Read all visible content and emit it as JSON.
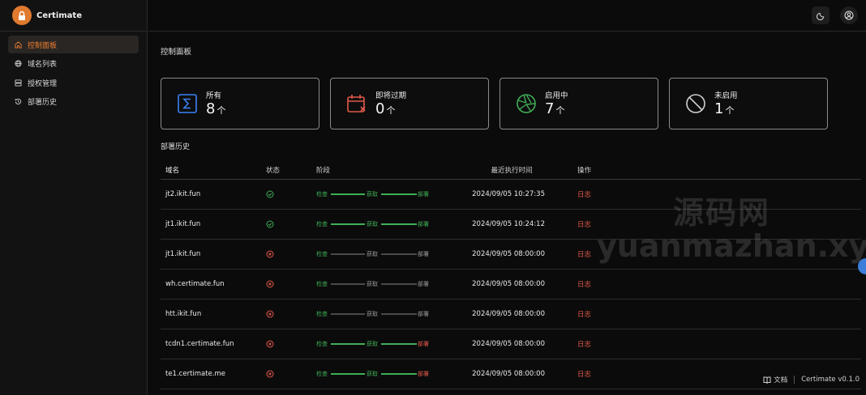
{
  "brand": {
    "name": "Certimate"
  },
  "sidebar": {
    "items": [
      {
        "label": "控制面板",
        "icon": "home-icon",
        "active": true
      },
      {
        "label": "域名列表",
        "icon": "globe-icon",
        "active": false
      },
      {
        "label": "授权管理",
        "icon": "server-icon",
        "active": false
      },
      {
        "label": "部署历史",
        "icon": "history-icon",
        "active": false
      }
    ]
  },
  "header": {
    "theme_icon": "moon-icon",
    "user_icon": "user-circle-icon"
  },
  "main": {
    "title": "控制面板",
    "cards": [
      {
        "label": "所有",
        "value": "8",
        "unit": "个",
        "icon": "sigma-icon",
        "color": "#3b82f6"
      },
      {
        "label": "即将过期",
        "value": "0",
        "unit": "个",
        "icon": "calendar-x-icon",
        "color": "#e05a4a"
      },
      {
        "label": "启用中",
        "value": "7",
        "unit": "个",
        "icon": "aperture-icon",
        "color": "#3fae56"
      },
      {
        "label": "未启用",
        "value": "1",
        "unit": "个",
        "icon": "ban-icon",
        "color": "#d0d0d0"
      }
    ],
    "history_title": "部署历史"
  },
  "table": {
    "headers": {
      "domain": "域名",
      "status": "状态",
      "stage": "阶段",
      "time": "最近执行时间",
      "op": "操作"
    },
    "stage_labels": [
      "检查",
      "获取",
      "部署"
    ],
    "rows": [
      {
        "domain": "jt2.ikit.fun",
        "status": "success",
        "stages": [
          "green",
          "green",
          "green"
        ],
        "time": "2024/09/05 10:27:35",
        "op": "日志"
      },
      {
        "domain": "jt1.ikit.fun",
        "status": "success",
        "stages": [
          "green",
          "green",
          "green"
        ],
        "time": "2024/09/05 10:24:12",
        "op": "日志"
      },
      {
        "domain": "jt1.ikit.fun",
        "status": "fail",
        "stages": [
          "green",
          "grey",
          "grey"
        ],
        "time": "2024/09/05 08:00:00",
        "op": "日志"
      },
      {
        "domain": "wh.certimate.fun",
        "status": "fail",
        "stages": [
          "green",
          "grey",
          "grey"
        ],
        "time": "2024/09/05 08:00:00",
        "op": "日志"
      },
      {
        "domain": "htt.ikit.fun",
        "status": "fail",
        "stages": [
          "green",
          "grey",
          "grey"
        ],
        "time": "2024/09/05 08:00:00",
        "op": "日志"
      },
      {
        "domain": "tcdn1.certimate.fun",
        "status": "fail",
        "stages": [
          "green",
          "green",
          "red"
        ],
        "time": "2024/09/05 08:00:00",
        "op": "日志"
      },
      {
        "domain": "te1.certimate.me",
        "status": "fail",
        "stages": [
          "green",
          "green",
          "red"
        ],
        "time": "2024/09/05 08:00:00",
        "op": "日志"
      }
    ]
  },
  "watermark": {
    "line1": "源码网",
    "line2": "yuanmazhan.xyz"
  },
  "footer": {
    "docs": "文档",
    "version": "Certimate v0.1.0"
  },
  "colors": {
    "accent": "#ef7d2f",
    "success": "#3fae56",
    "danger": "#e05a4a"
  }
}
